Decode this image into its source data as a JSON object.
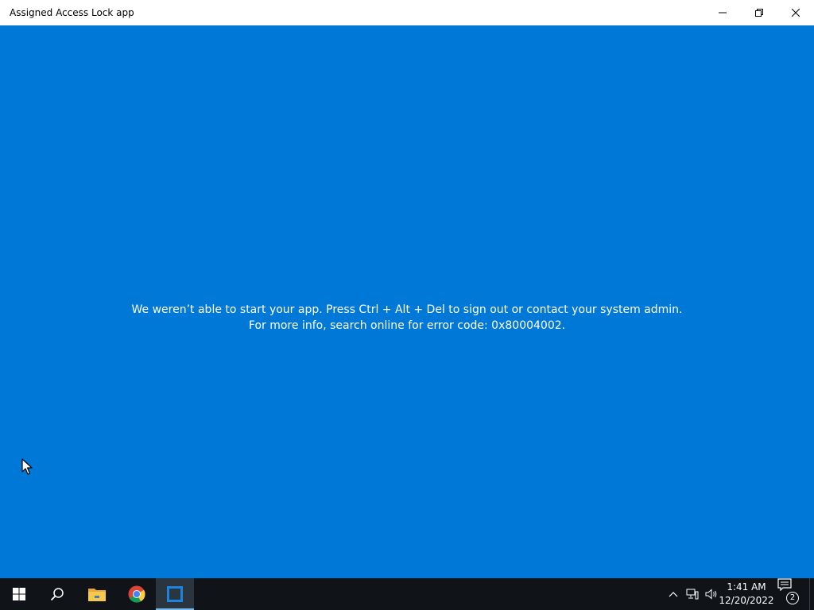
{
  "window": {
    "title": "Assigned Access Lock app",
    "controls": {
      "minimize": "minimize-icon",
      "maximize": "restore-icon",
      "close": "close-icon"
    }
  },
  "error": {
    "line1": "We weren’t able to start your app. Press Ctrl + Alt + Del to sign out or contact your system admin.",
    "line2": "For more info, search online for error code: 0x80004002."
  },
  "taskbar": {
    "apps": [
      {
        "name": "Start",
        "icon": "windows-logo-icon"
      },
      {
        "name": "Search",
        "icon": "search-icon"
      },
      {
        "name": "File Explorer",
        "icon": "folder-icon"
      },
      {
        "name": "Google Chrome",
        "icon": "chrome-icon"
      },
      {
        "name": "Assigned Access Lock app",
        "icon": "app-window-icon",
        "active": true
      }
    ],
    "tray": {
      "icons": [
        "chevron-up-icon",
        "network-icon",
        "volume-icon"
      ],
      "time": "1:41 AM",
      "date": "12/20/2022",
      "notification_count": "2"
    }
  },
  "colors": {
    "background": "#0078d7",
    "titlebar": "#ffffff",
    "taskbar": "#101419",
    "active_indicator": "#76b9ed"
  }
}
